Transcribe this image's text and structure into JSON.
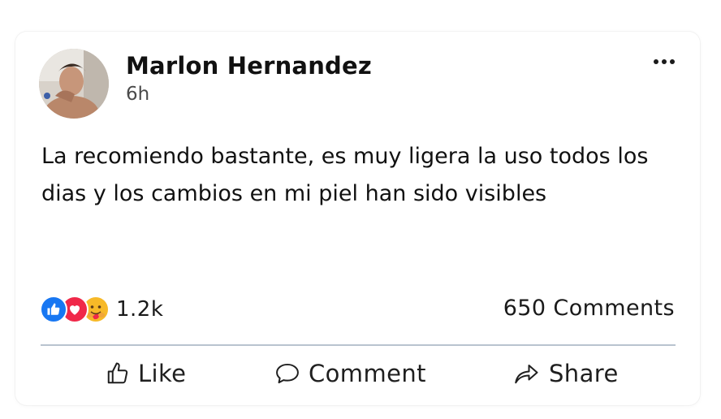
{
  "post": {
    "author_name": "Marlon Hernandez",
    "time": "6h",
    "text": "La recomiendo bastante, es muy ligera la uso todos los dias y los cambios en mi piel han sido visibles"
  },
  "engagement": {
    "reaction_count": "1.2k",
    "reaction_icons": [
      "like-icon",
      "love-icon",
      "care-icon"
    ],
    "comments_count": "650 Comments"
  },
  "actions": {
    "like_label": "Like",
    "comment_label": "Comment",
    "share_label": "Share"
  },
  "colors": {
    "like_blue": "#1877f2",
    "love_red": "#f02849",
    "care_yellow": "#f7b928",
    "divider": "#b9c3cf"
  }
}
